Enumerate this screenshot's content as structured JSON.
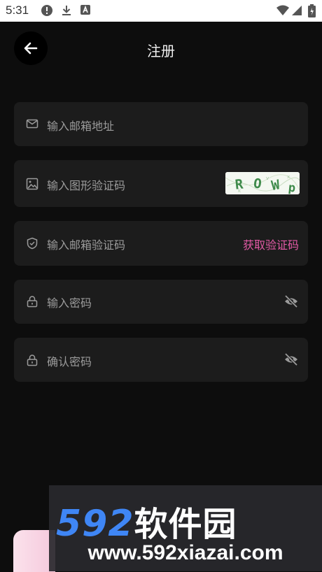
{
  "status_bar": {
    "time": "5:31",
    "icons": [
      "alert-circle-icon",
      "download-icon",
      "a-box-icon",
      "wifi-icon",
      "signal-icon",
      "battery-icon"
    ]
  },
  "header": {
    "title": "注册",
    "back_icon": "arrow-left-icon"
  },
  "form": {
    "email": {
      "placeholder": "输入邮箱地址",
      "icon": "mail-icon"
    },
    "captcha": {
      "placeholder": "输入图形验证码",
      "icon": "image-icon",
      "image_text": "ROWp"
    },
    "email_code": {
      "placeholder": "输入邮箱验证码",
      "icon": "shield-icon",
      "action_label": "获取验证码"
    },
    "password": {
      "placeholder": "输入密码",
      "icon": "lock-icon",
      "toggle_icon": "eye-off-icon"
    },
    "confirm_password": {
      "placeholder": "确认密码",
      "icon": "lock-icon",
      "toggle_icon": "eye-off-icon"
    }
  },
  "watermark": {
    "brand_number": "592",
    "brand_text": "软件园",
    "url": "www.592xiazai.com"
  },
  "colors": {
    "background": "#0d0d0d",
    "field": "#1c1c1c",
    "accent": "#e35aa6",
    "placeholder": "#9b9b9b"
  }
}
